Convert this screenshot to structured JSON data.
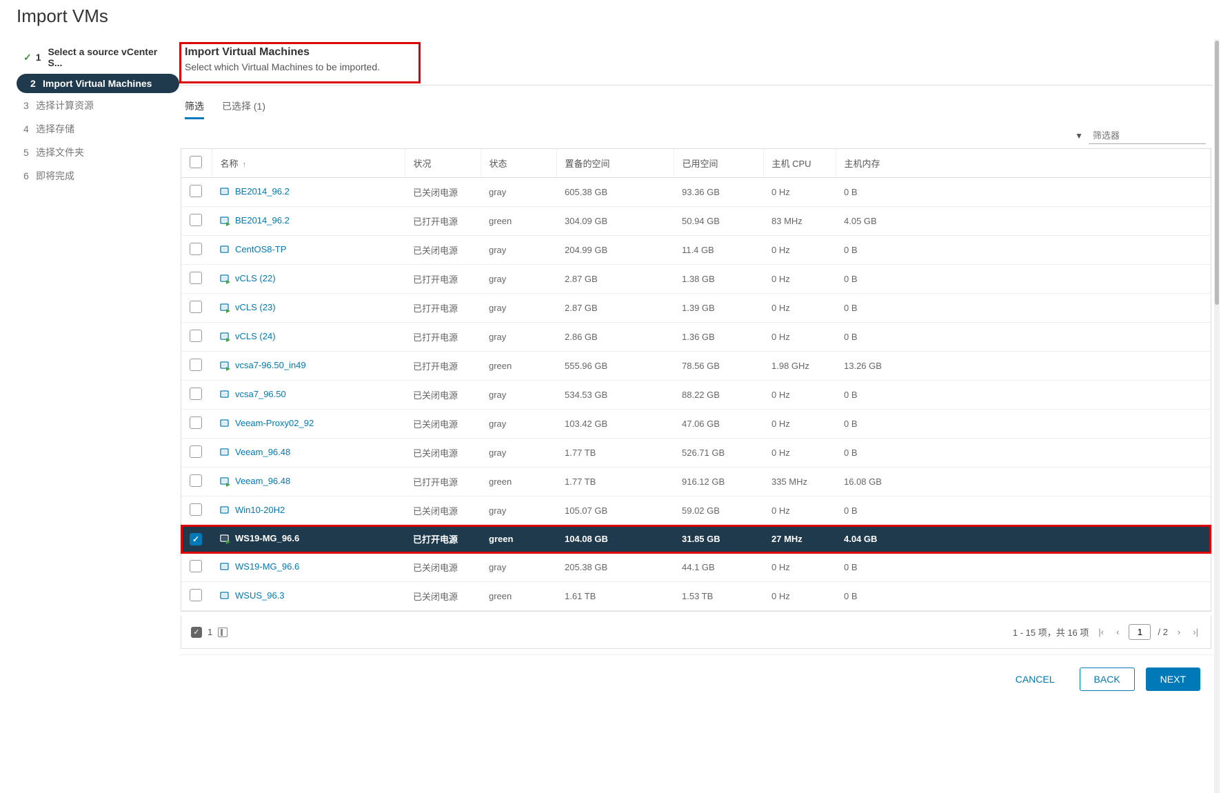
{
  "dialog": {
    "title": "Import VMs"
  },
  "steps": [
    {
      "num": "1",
      "label": "Select a source vCenter S...",
      "state": "done"
    },
    {
      "num": "2",
      "label": "Import Virtual Machines",
      "state": "active"
    },
    {
      "num": "3",
      "label": "选择计算资源",
      "state": "pending"
    },
    {
      "num": "4",
      "label": "选择存储",
      "state": "pending"
    },
    {
      "num": "5",
      "label": "选择文件夹",
      "state": "pending"
    },
    {
      "num": "6",
      "label": "即将完成",
      "state": "pending"
    }
  ],
  "section": {
    "title": "Import Virtual Machines",
    "subtitle": "Select which Virtual Machines to be imported."
  },
  "tabs": {
    "filter": "筛选",
    "selected": "已选择 (1)"
  },
  "filter": {
    "placeholder": "筛选器"
  },
  "columns": {
    "name": "名称",
    "power": "状况",
    "status": "状态",
    "prov": "置备的空间",
    "used": "已用空间",
    "cpu": "主机 CPU",
    "mem": "主机内存"
  },
  "rows": [
    {
      "sel": false,
      "on": false,
      "name": "BE2014_96.2",
      "power": "已关闭电源",
      "status": "gray",
      "prov": "605.38 GB",
      "used": "93.36 GB",
      "cpu": "0 Hz",
      "mem": "0 B"
    },
    {
      "sel": false,
      "on": true,
      "name": "BE2014_96.2",
      "power": "已打开电源",
      "status": "green",
      "prov": "304.09 GB",
      "used": "50.94 GB",
      "cpu": "83 MHz",
      "mem": "4.05 GB"
    },
    {
      "sel": false,
      "on": false,
      "name": "CentOS8-TP",
      "power": "已关闭电源",
      "status": "gray",
      "prov": "204.99 GB",
      "used": "11.4 GB",
      "cpu": "0 Hz",
      "mem": "0 B"
    },
    {
      "sel": false,
      "on": true,
      "name": "vCLS (22)",
      "power": "已打开电源",
      "status": "gray",
      "prov": "2.87 GB",
      "used": "1.38 GB",
      "cpu": "0 Hz",
      "mem": "0 B"
    },
    {
      "sel": false,
      "on": true,
      "name": "vCLS (23)",
      "power": "已打开电源",
      "status": "gray",
      "prov": "2.87 GB",
      "used": "1.39 GB",
      "cpu": "0 Hz",
      "mem": "0 B"
    },
    {
      "sel": false,
      "on": true,
      "name": "vCLS (24)",
      "power": "已打开电源",
      "status": "gray",
      "prov": "2.86 GB",
      "used": "1.36 GB",
      "cpu": "0 Hz",
      "mem": "0 B"
    },
    {
      "sel": false,
      "on": true,
      "name": "vcsa7-96.50_in49",
      "power": "已打开电源",
      "status": "green",
      "prov": "555.96 GB",
      "used": "78.56 GB",
      "cpu": "1.98 GHz",
      "mem": "13.26 GB"
    },
    {
      "sel": false,
      "on": false,
      "name": "vcsa7_96.50",
      "power": "已关闭电源",
      "status": "gray",
      "prov": "534.53 GB",
      "used": "88.22 GB",
      "cpu": "0 Hz",
      "mem": "0 B"
    },
    {
      "sel": false,
      "on": false,
      "name": "Veeam-Proxy02_92",
      "power": "已关闭电源",
      "status": "gray",
      "prov": "103.42 GB",
      "used": "47.06 GB",
      "cpu": "0 Hz",
      "mem": "0 B"
    },
    {
      "sel": false,
      "on": false,
      "name": "Veeam_96.48",
      "power": "已关闭电源",
      "status": "gray",
      "prov": "1.77 TB",
      "used": "526.71 GB",
      "cpu": "0 Hz",
      "mem": "0 B"
    },
    {
      "sel": false,
      "on": true,
      "name": "Veeam_96.48",
      "power": "已打开电源",
      "status": "green",
      "prov": "1.77 TB",
      "used": "916.12 GB",
      "cpu": "335 MHz",
      "mem": "16.08 GB"
    },
    {
      "sel": false,
      "on": false,
      "name": "Win10-20H2",
      "power": "已关闭电源",
      "status": "gray",
      "prov": "105.07 GB",
      "used": "59.02 GB",
      "cpu": "0 Hz",
      "mem": "0 B"
    },
    {
      "sel": true,
      "on": true,
      "name": "WS19-MG_96.6",
      "power": "已打开电源",
      "status": "green",
      "prov": "104.08 GB",
      "used": "31.85 GB",
      "cpu": "27 MHz",
      "mem": "4.04 GB",
      "highlight": true
    },
    {
      "sel": false,
      "on": false,
      "name": "WS19-MG_96.6",
      "power": "已关闭电源",
      "status": "gray",
      "prov": "205.38 GB",
      "used": "44.1 GB",
      "cpu": "0 Hz",
      "mem": "0 B"
    },
    {
      "sel": false,
      "on": false,
      "name": "WSUS_96.3",
      "power": "已关闭电源",
      "status": "green",
      "prov": "1.61 TB",
      "used": "1.53 TB",
      "cpu": "0 Hz",
      "mem": "0 B"
    }
  ],
  "pager": {
    "selected_count": "1",
    "summary": "1 - 15 项，共 16 项",
    "page": "1",
    "total": "/ 2"
  },
  "footer": {
    "cancel": "CANCEL",
    "back": "BACK",
    "next": "NEXT"
  }
}
